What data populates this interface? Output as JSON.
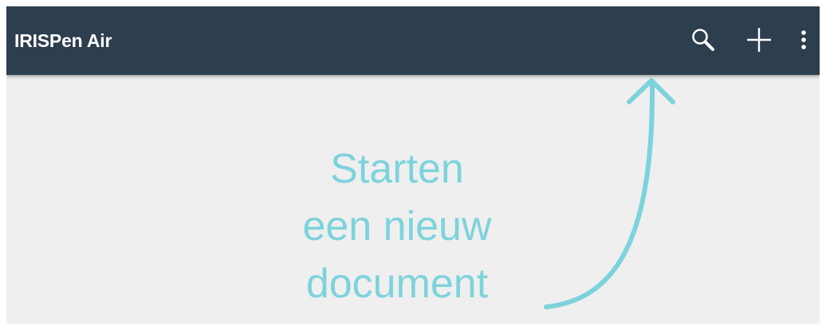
{
  "app": {
    "title": "IRISPen Air"
  },
  "toolbar": {
    "actions": [
      {
        "name": "search",
        "icon": "search-icon"
      },
      {
        "name": "new-document",
        "icon": "plus-icon"
      },
      {
        "name": "more",
        "icon": "more-vertical-icon"
      }
    ]
  },
  "coachmark": {
    "line1": "Starten",
    "line2": "een nieuw",
    "line3": "document",
    "pointer_icon": "curved-arrow-up-icon"
  },
  "colors": {
    "toolbar_bg": "#2d3e4e",
    "content_bg": "#efefef",
    "accent": "#7dd3dc",
    "toolbar_text": "#ffffff"
  }
}
